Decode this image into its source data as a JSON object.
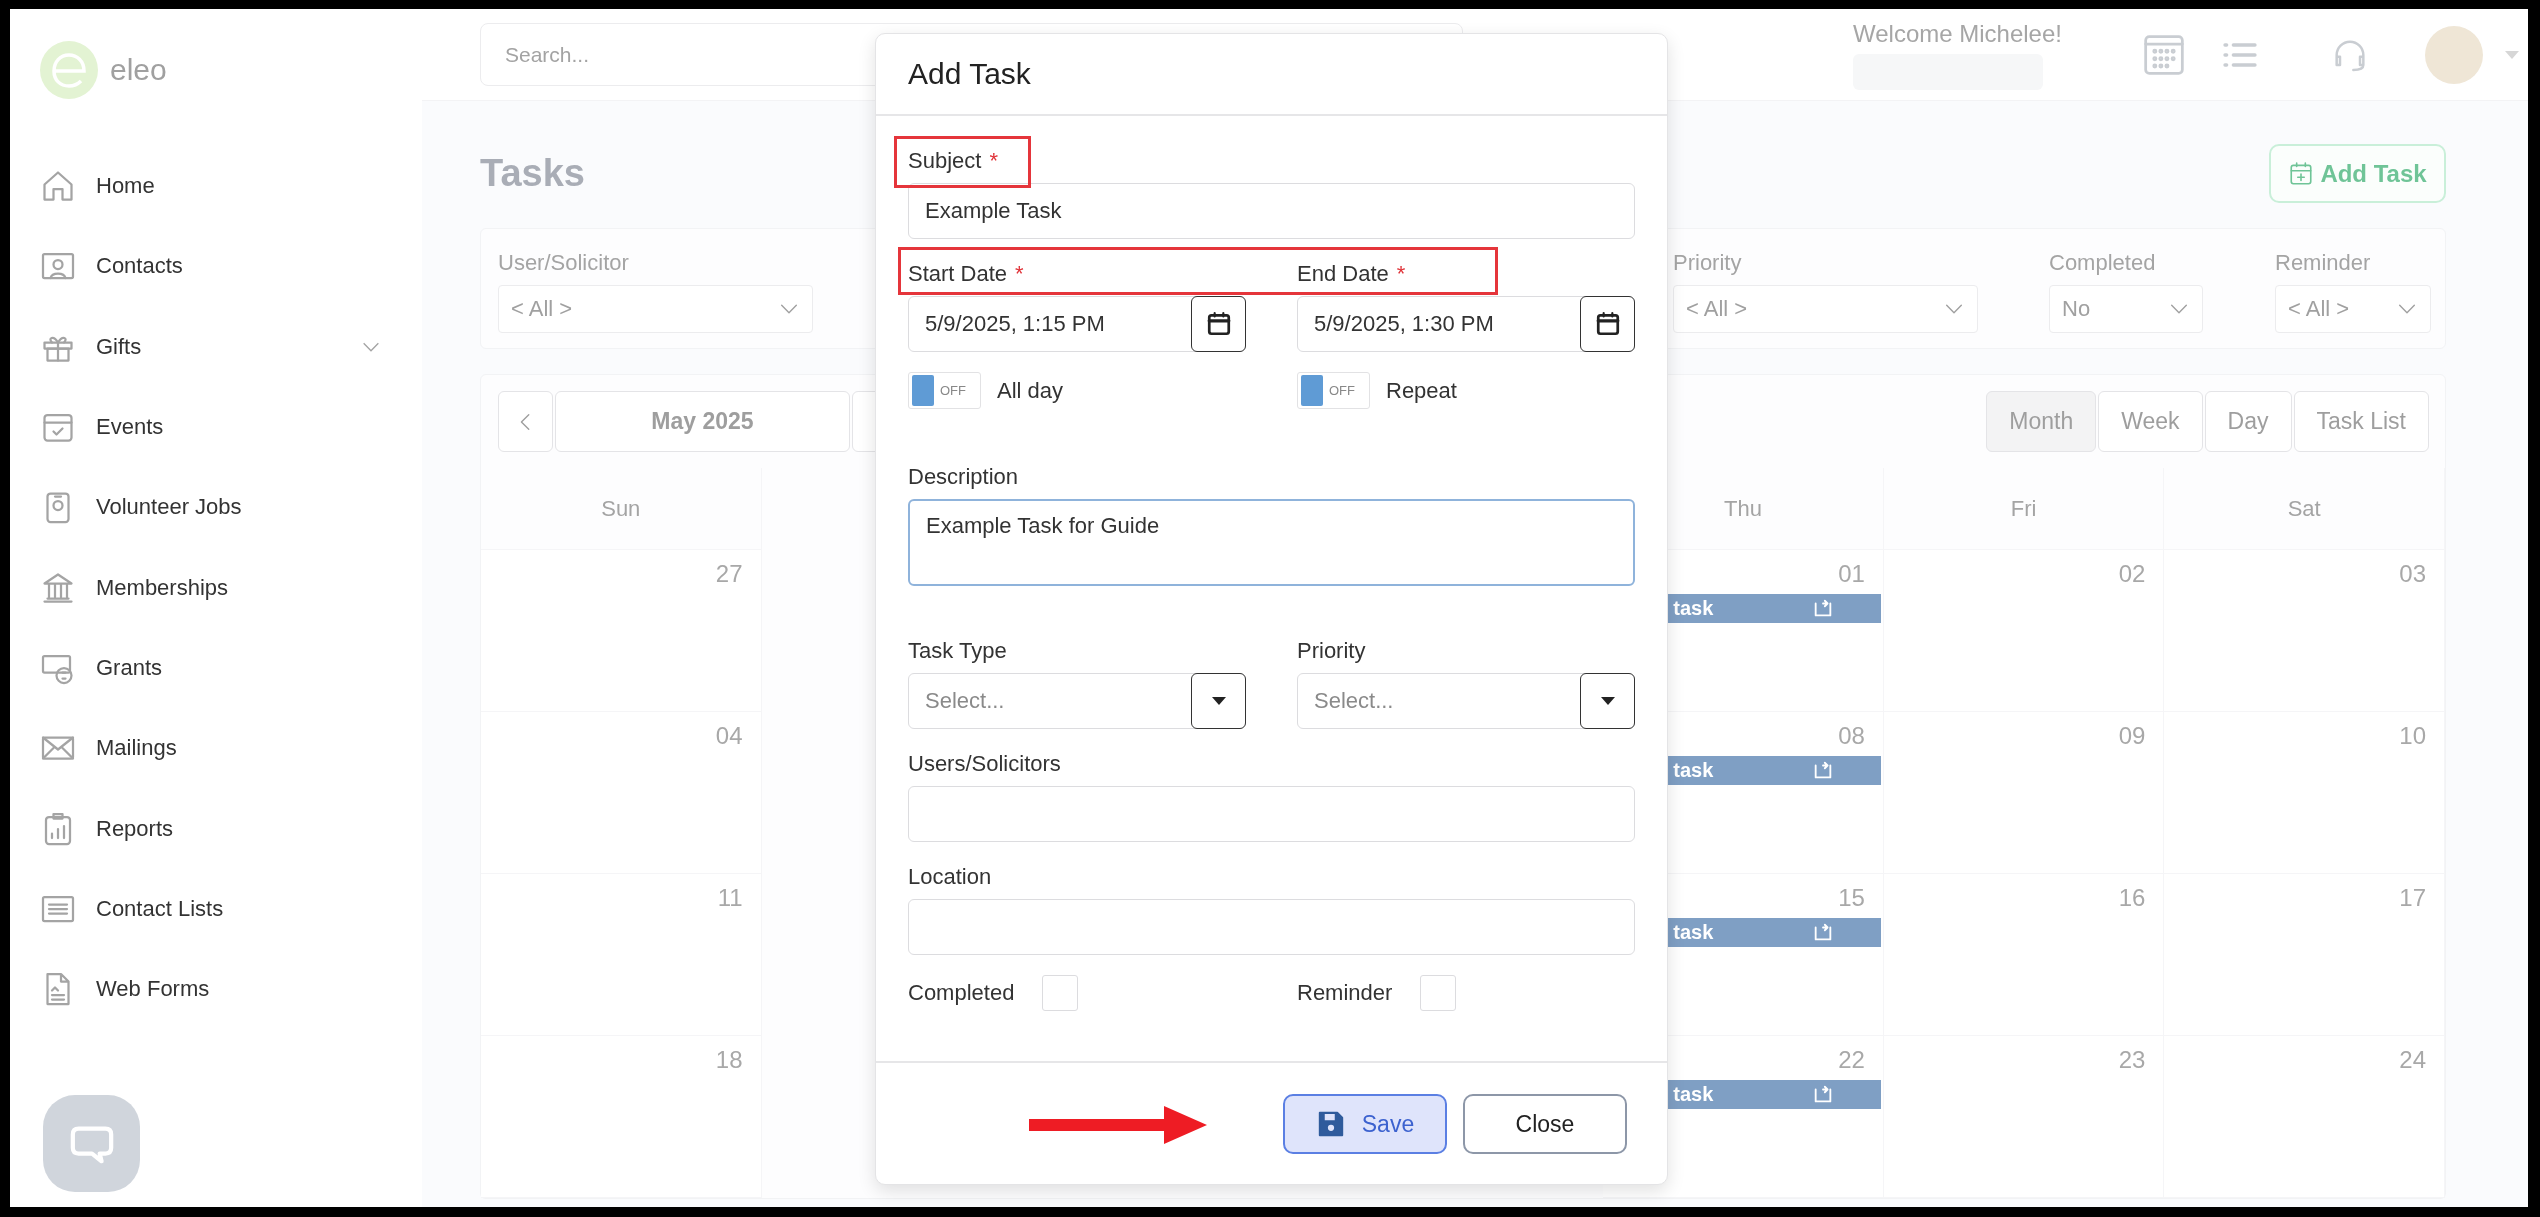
{
  "sidebar": {
    "logo_text": "eleo",
    "items": [
      {
        "label": "Home",
        "has_submenu": false
      },
      {
        "label": "Contacts",
        "has_submenu": false
      },
      {
        "label": "Gifts",
        "has_submenu": true
      },
      {
        "label": "Events",
        "has_submenu": false
      },
      {
        "label": "Volunteer Jobs",
        "has_submenu": false
      },
      {
        "label": "Memberships",
        "has_submenu": false
      },
      {
        "label": "Grants",
        "has_submenu": false
      },
      {
        "label": "Mailings",
        "has_submenu": false
      },
      {
        "label": "Reports",
        "has_submenu": false
      },
      {
        "label": "Contact Lists",
        "has_submenu": false
      },
      {
        "label": "Web Forms",
        "has_submenu": false
      }
    ]
  },
  "top_bar": {
    "search": {
      "placeholder": "Search..."
    },
    "welcome": "Welcome Michelee!"
  },
  "page": {
    "title": "Tasks",
    "add_button": "Add Task"
  },
  "filters": [
    {
      "label": "User/Solicitor",
      "value": "< All >"
    },
    {
      "label": "Priority",
      "value": "< All >"
    },
    {
      "label": "Completed",
      "value": "No"
    },
    {
      "label": "Reminder",
      "value": "< All >"
    }
  ],
  "calendar": {
    "period": "May 2025",
    "views": [
      {
        "label": "Month",
        "selected": true
      },
      {
        "label": "Week",
        "selected": false
      },
      {
        "label": "Day",
        "selected": false
      },
      {
        "label": "Task List",
        "selected": false
      }
    ],
    "columns": [
      {
        "day": "Sun",
        "cells": [
          {
            "date": "27"
          },
          {
            "date": "04"
          },
          {
            "date": "11"
          },
          {
            "date": "18"
          }
        ]
      },
      {
        "day": "Thu",
        "cells": [
          {
            "date": "01",
            "event": "task"
          },
          {
            "date": "08",
            "event": "task"
          },
          {
            "date": "15",
            "event": "task"
          },
          {
            "date": "22",
            "event": "task"
          }
        ]
      },
      {
        "day": "Fri",
        "cells": [
          {
            "date": "02"
          },
          {
            "date": "09"
          },
          {
            "date": "16"
          },
          {
            "date": "23"
          }
        ]
      },
      {
        "day": "Sat",
        "cells": [
          {
            "date": "03"
          },
          {
            "date": "10"
          },
          {
            "date": "17"
          },
          {
            "date": "24"
          }
        ]
      }
    ]
  },
  "modal": {
    "title": "Add Task",
    "rows": [
      {
        "kind": "text",
        "label": "Subject",
        "required_mark": "*",
        "value": "Example Task"
      },
      {
        "kind": "pair",
        "items": [
          {
            "kind": "date",
            "label": "Start Date",
            "required_mark": "*",
            "value": "5/9/2025, 1:15 PM"
          },
          {
            "kind": "date",
            "label": "End Date",
            "required_mark": "*",
            "value": "5/9/2025, 1:30 PM"
          }
        ]
      },
      {
        "kind": "pair",
        "items": [
          {
            "kind": "toggle",
            "label": "All day",
            "on": false,
            "state_text": "OFF"
          },
          {
            "kind": "toggle",
            "label": "Repeat",
            "on": false,
            "state_text": "OFF"
          }
        ]
      },
      {
        "kind": "textarea",
        "label": "Description",
        "value": "Example Task for Guide",
        "focused": true
      },
      {
        "kind": "pair",
        "items": [
          {
            "kind": "select",
            "label": "Task Type",
            "placeholder": "Select..."
          },
          {
            "kind": "select",
            "label": "Priority",
            "placeholder": "Select..."
          }
        ]
      },
      {
        "kind": "text",
        "label": "Users/Solicitors"
      },
      {
        "kind": "text",
        "label": "Location"
      },
      {
        "kind": "pair",
        "items": [
          {
            "kind": "checkbox",
            "label": "Completed",
            "checked": false
          },
          {
            "kind": "checkbox",
            "label": "Reminder",
            "checked": false
          }
        ]
      }
    ],
    "buttons": [
      {
        "label": "Save",
        "kind": "primary"
      },
      {
        "label": "Close",
        "kind": "secondary"
      }
    ]
  }
}
